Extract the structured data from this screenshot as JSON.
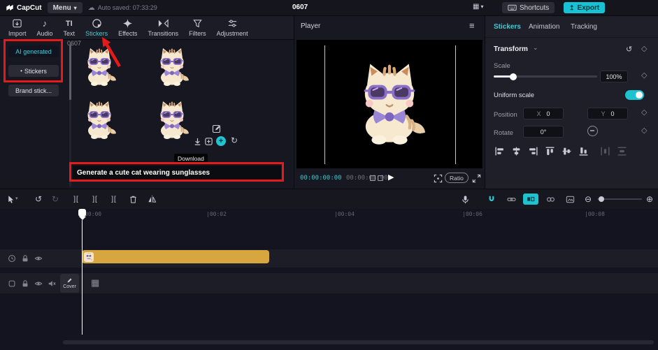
{
  "topbar": {
    "logo_text": "CapCut",
    "menu_label": "Menu",
    "autosave_text": "Auto saved: 07:33:29",
    "project_title": "0607",
    "shortcuts_label": "Shortcuts",
    "export_label": "Export"
  },
  "icons": {
    "caret_down": "▾",
    "cloud": "☁",
    "layout_grid": "▦",
    "export_arrow": "↥",
    "hamburger": "≡",
    "music_note": "♪",
    "text_tool": "TI",
    "play": "▶",
    "undo": "↺",
    "redo": "↻",
    "split": "][",
    "zoom_out": "⊖",
    "zoom_in": "⊕",
    "plus": "+",
    "refresh": "↻",
    "diamond": "◇",
    "section_caret": "⌄",
    "dot": "•",
    "film": "▦"
  },
  "media_toolbar": {
    "tabs": [
      {
        "label": "Import"
      },
      {
        "label": "Audio"
      },
      {
        "label": "Text"
      },
      {
        "label": "Stickers"
      },
      {
        "label": "Effects"
      },
      {
        "label": "Transitions"
      },
      {
        "label": "Filters"
      },
      {
        "label": "Adjustment"
      }
    ]
  },
  "sidebar": {
    "items": [
      {
        "label": "AI generated"
      },
      {
        "label": "Stickers"
      },
      {
        "label": "Brand stick..."
      }
    ]
  },
  "stickers": {
    "section_label": "0607",
    "tooltip_download": "Download",
    "prompt_text": "Generate a cute cat wearing sunglasses"
  },
  "player": {
    "title": "Player",
    "current_time": "00:00:00:00",
    "duration": "00:00:03:00",
    "ratio_label": "Ratio"
  },
  "properties": {
    "tabs": [
      {
        "label": "Stickers"
      },
      {
        "label": "Animation"
      },
      {
        "label": "Tracking"
      }
    ],
    "transform_title": "Transform",
    "scale_label": "Scale",
    "scale_value": "100%",
    "uniform_label": "Uniform scale",
    "position_label": "Position",
    "x_label": "X",
    "x_value": "0",
    "y_label": "Y",
    "y_value": "0",
    "rotate_label": "Rotate",
    "rotate_value": "0°"
  },
  "timeline": {
    "ticks": [
      "00:00",
      "|00:02",
      "|00:04",
      "|00:06",
      "|00:08"
    ],
    "cover_label": "Cover"
  }
}
